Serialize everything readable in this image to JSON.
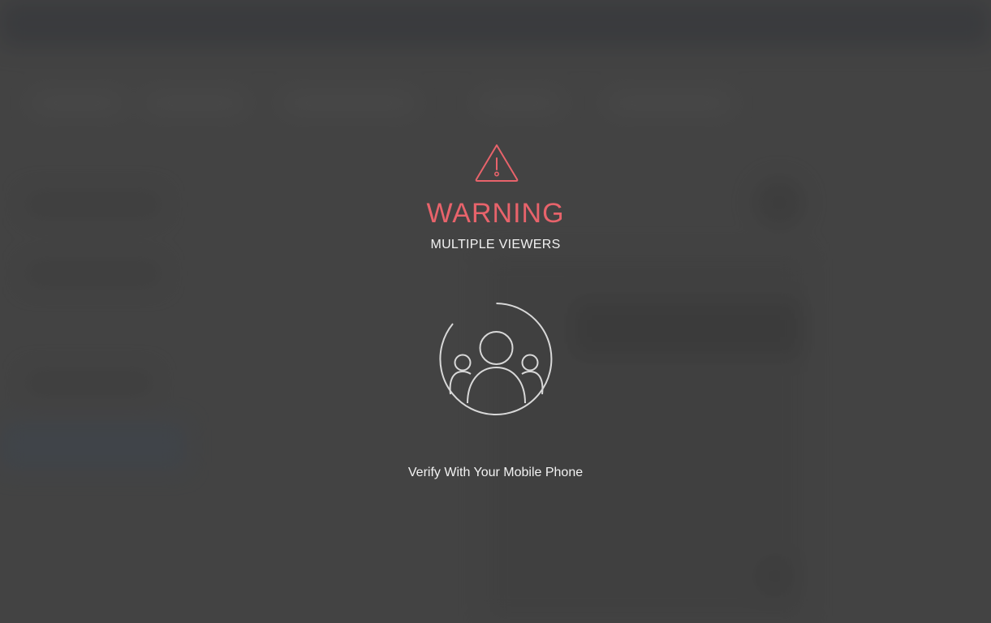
{
  "warning": {
    "title": "WARNING",
    "subtitle": "MULTIPLE VIEWERS",
    "icon": "warning-triangle-icon",
    "viewers_icon": "multiple-viewers-icon",
    "verify_label": "Verify With Your Mobile Phone"
  },
  "colors": {
    "accent": "#e8636b",
    "text": "#f2f2f2",
    "background": "#444444",
    "icon_stroke": "#d8d8d8"
  }
}
